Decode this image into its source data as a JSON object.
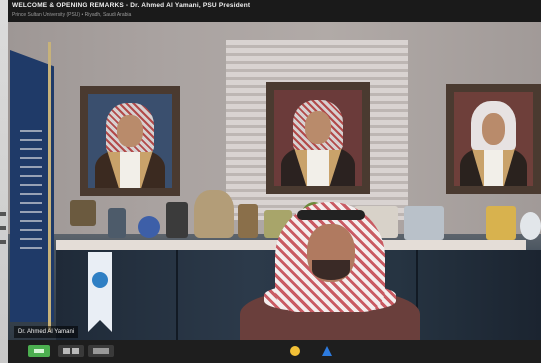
{
  "meeting": {
    "title": "WELCOME & OPENING REMARKS - Dr. Ahmed Al Yamani, PSU President",
    "subtitle": "Prince Sultan University (PSU) • Riyadh, Saudi Arabia"
  },
  "participant": {
    "name": "Dr. Ahmed Al Yamani"
  },
  "toolbar": {
    "buttons": [
      {
        "name": "green-indicator-button",
        "icon": "status-indicator"
      },
      {
        "name": "gallery-view-button",
        "icon": "gallery-icon"
      },
      {
        "name": "share-button",
        "icon": "share-icon"
      },
      {
        "name": "reactions-button",
        "icon": "hand-icon"
      },
      {
        "name": "ratings-button",
        "icon": "stars-icon"
      }
    ]
  },
  "colors": {
    "toolbar_bg": "#1e1e1e",
    "title_bg": "#1a1a1a",
    "indicator": "#4caf50",
    "share": "#2d7be0",
    "reaction": "#f2c037"
  }
}
